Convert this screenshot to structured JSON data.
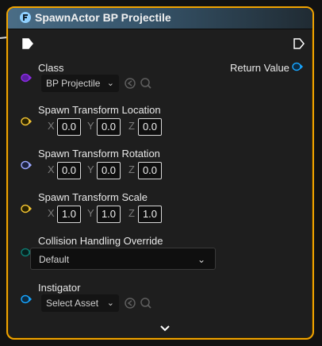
{
  "node": {
    "title": "SpawnActor BP Projectile",
    "return_label": "Return Value",
    "class": {
      "label": "Class",
      "value": "BP Projectile"
    },
    "location": {
      "label": "Spawn Transform Location",
      "axes": [
        "X",
        "Y",
        "Z"
      ],
      "values": [
        "0.0",
        "0.0",
        "0.0"
      ]
    },
    "rotation": {
      "label": "Spawn Transform Rotation",
      "axes": [
        "X",
        "Y",
        "Z"
      ],
      "values": [
        "0.0",
        "0.0",
        "0.0"
      ]
    },
    "scale": {
      "label": "Spawn Transform Scale",
      "axes": [
        "X",
        "Y",
        "Z"
      ],
      "values": [
        "1.0",
        "1.0",
        "1.0"
      ]
    },
    "collision": {
      "label": "Collision Handling Override",
      "value": "Default"
    },
    "instigator": {
      "label": "Instigator",
      "placeholder": "Select Asset"
    }
  },
  "colors": {
    "border": "#f2a400",
    "class_pin": "#8a2be2",
    "vector_pin": "#f1c232",
    "rotator_pin": "#9aa6ff",
    "enum_pin": "#0e7a70",
    "object_pin": "#17a5ff"
  },
  "icons": [
    "function-icon",
    "exec-pin-icon",
    "browse-icon",
    "search-icon",
    "chevron-down-icon",
    "object-pin-icon"
  ]
}
